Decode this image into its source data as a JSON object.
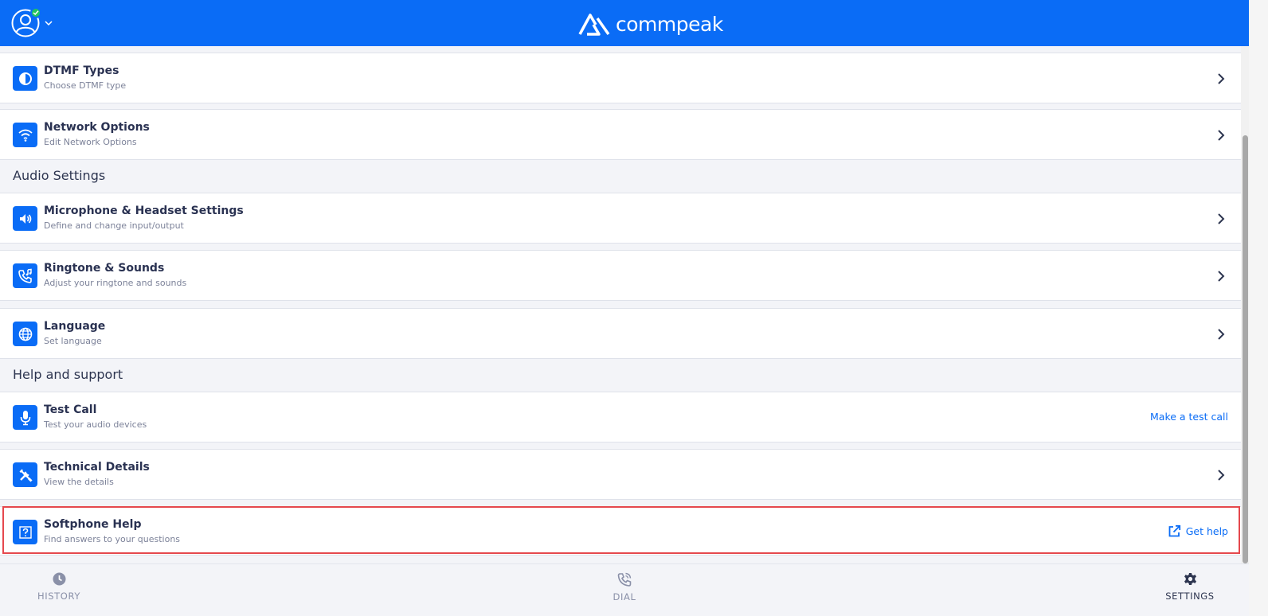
{
  "app": {
    "brand": "commpeak",
    "colors": {
      "primary": "#0a6cf6",
      "highlight": "#e5484d",
      "online": "#22c55e"
    },
    "avatar_icon": "user-circle-icon",
    "status_icon": "check-icon"
  },
  "settings": {
    "rows_top": [
      {
        "title": "DTMF Types",
        "subtitle": "Choose DTMF type",
        "icon": "dtmf-icon"
      },
      {
        "title": "Network Options",
        "subtitle": "Edit Network Options",
        "icon": "wifi-icon"
      }
    ],
    "audio": {
      "section_title": "Audio Settings",
      "rows": [
        {
          "title": "Microphone & Headset Settings",
          "subtitle": "Define and change input/output",
          "icon": "speaker-icon"
        },
        {
          "title": "Ringtone & Sounds",
          "subtitle": "Adjust your ringtone and sounds",
          "icon": "phone-music-icon"
        },
        {
          "title": "Language",
          "subtitle": "Set language",
          "icon": "globe-icon"
        }
      ]
    },
    "help": {
      "section_title": "Help and support",
      "test_call": {
        "title": "Test Call",
        "subtitle": "Test your audio devices",
        "icon": "microphone-icon",
        "action": "Make a test call"
      },
      "technical": {
        "title": "Technical Details",
        "subtitle": "View the details",
        "icon": "tools-icon"
      },
      "softphone_help": {
        "title": "Softphone Help",
        "subtitle": "Find answers to your questions",
        "icon": "question-icon",
        "action": "Get help",
        "action_icon": "external-link-icon"
      }
    }
  },
  "nav": {
    "items": [
      {
        "label": "HISTORY",
        "icon": "clock-icon",
        "active": false
      },
      {
        "label": "DIAL",
        "icon": "phone-icon",
        "active": false
      },
      {
        "label": "SETTINGS",
        "icon": "gear-icon",
        "active": true
      }
    ]
  }
}
